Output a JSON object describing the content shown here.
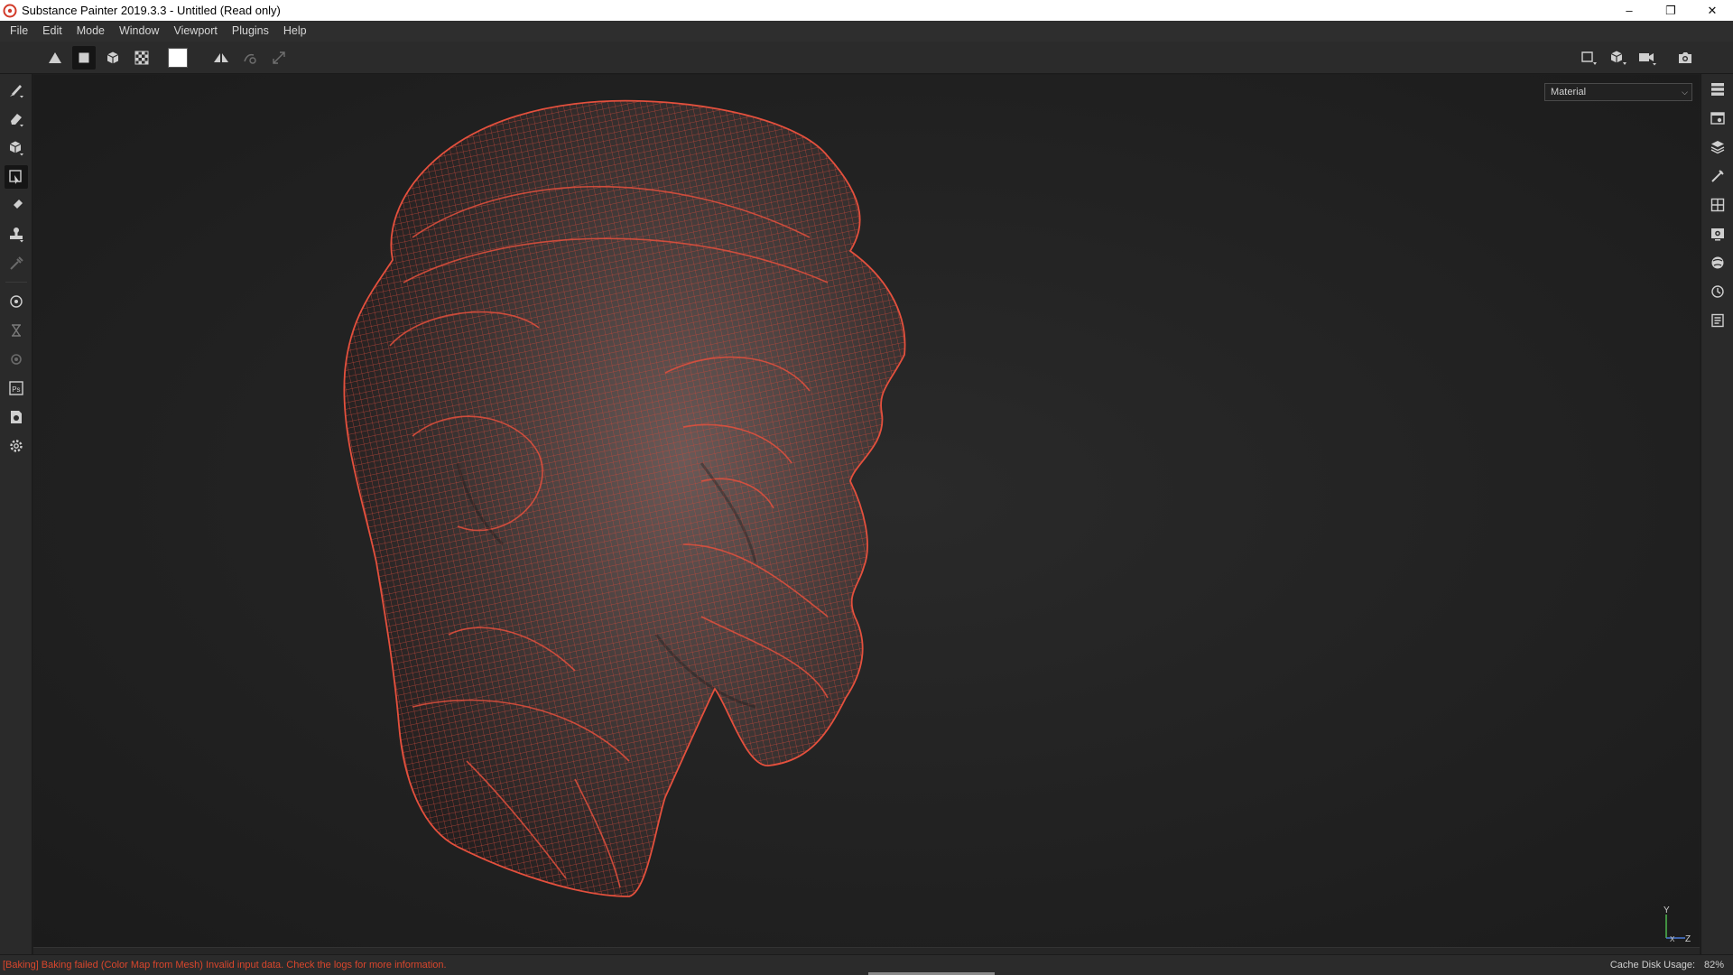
{
  "window": {
    "title": "Substance Painter 2019.3.3 - Untitled (Read only)",
    "controls": {
      "minimize": "–",
      "restore": "❐",
      "close": "✕"
    }
  },
  "menu": [
    "File",
    "Edit",
    "Mode",
    "Window",
    "Viewport",
    "Plugins",
    "Help"
  ],
  "toolbar": {
    "left_icons": [
      "triangle-fill-icon",
      "square-fill-icon",
      "cube-icon",
      "checker-icon",
      "color-swatch-icon",
      "symmetry-icon",
      "lazy-mouse-icon",
      "pen-pressure-icon"
    ],
    "active_icon": "square-fill-icon",
    "right_icons": [
      "2d-view-icon",
      "3d-view-icon",
      "camera-icon",
      "screenshot-icon"
    ],
    "swatch_color": "#ffffff"
  },
  "left_tools": [
    "paint-brush-icon",
    "eraser-icon",
    "projection-icon",
    "polygon-fill-icon",
    "smudge-icon",
    "clone-stamp-icon",
    "color-picker-icon",
    "bake-settings-icon",
    "iray-icon",
    "export-icon",
    "photoshop-icon",
    "document-icon",
    "settings-icon"
  ],
  "left_active": "polygon-fill-icon",
  "right_panels": [
    "texture-set-list-icon",
    "texture-set-settings-icon",
    "layers-icon",
    "properties-icon",
    "display-settings-icon",
    "viewer-settings-icon",
    "shader-settings-icon",
    "history-icon",
    "log-icon"
  ],
  "viewport": {
    "channel_selected": "Material",
    "axis_labels": {
      "y": "Y",
      "x": "X",
      "z": "Z"
    },
    "wire_color": "#e4503d"
  },
  "status": {
    "message": "[Baking] Baking failed (Color Map from Mesh) Invalid input data. Check the logs for more information.",
    "cache_label": "Cache Disk Usage:",
    "cache_value": "82%"
  }
}
